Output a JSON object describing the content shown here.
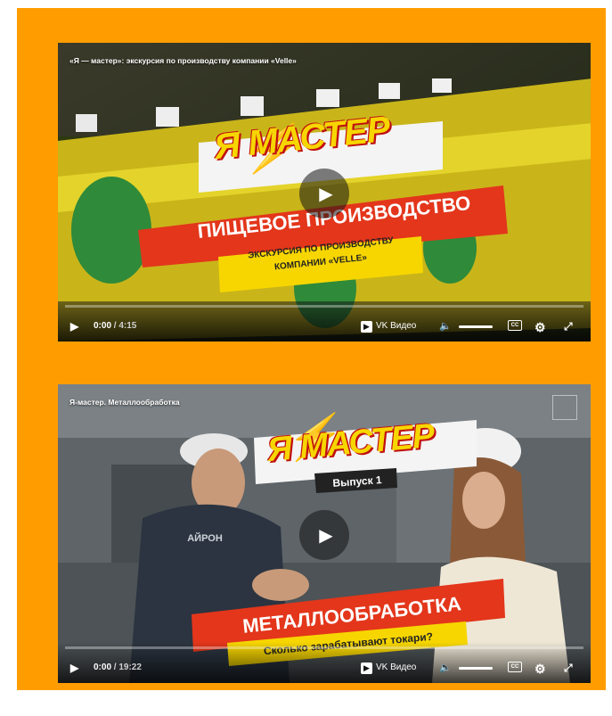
{
  "videos": [
    {
      "title": "«Я — мастер»: экскурсия по производству компании «Velle»",
      "logo": "Я МАСТЕР",
      "banner_main": "ПИЩЕВОЕ ПРОИЗВОДСТВО",
      "banner_sub_1": "ЭКСКУРСИЯ ПО ПРОИЗВОДСТВУ",
      "banner_sub_2": "КОМПАНИИ «VELLE»",
      "current_time": "0:00",
      "duration": "/ 4:15",
      "platform": "VK Видео",
      "progress": 0
    },
    {
      "title": "Я-мастер. Металлообработка",
      "logo": "Я МАСТЕР",
      "episode": "Выпуск 1",
      "shirt_text": "АЙРОН",
      "banner_main": "МЕТАЛЛООБРАБОТКА",
      "banner_sub": "Сколько зарабатывают токари?",
      "current_time": "0:00",
      "duration": "/ 19:22",
      "platform": "VK Видео",
      "progress": 0
    }
  ],
  "icons": {
    "play": "▶",
    "volume": "🔈",
    "settings": "⚙",
    "fullscreen": "⤢",
    "subtitles": "CC"
  },
  "colors": {
    "panel": "#FF9D00",
    "banner_red": "#E3361B",
    "banner_yellow": "#F7D600"
  }
}
